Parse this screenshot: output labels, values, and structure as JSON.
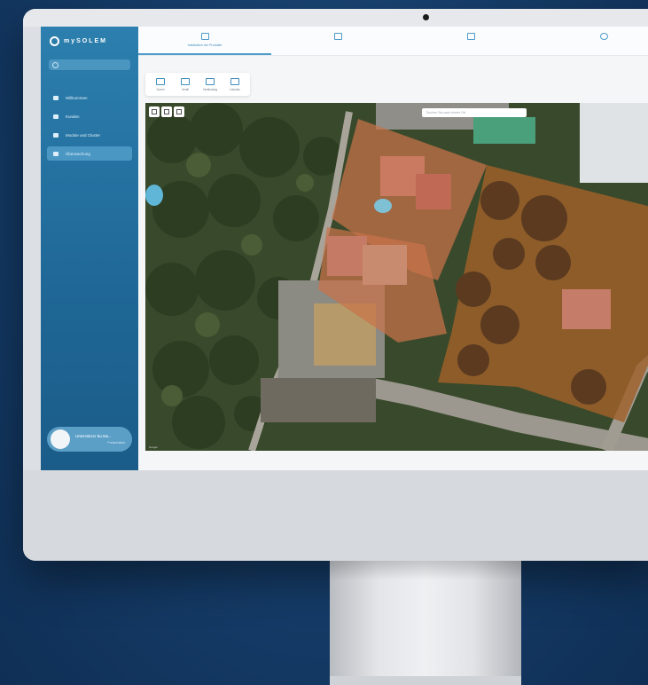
{
  "app": {
    "brand": "mySOLEM"
  },
  "sidebar": {
    "search_placeholder": "",
    "items": [
      {
        "label": "Willkommen",
        "icon": "home-icon"
      },
      {
        "label": "Kunden",
        "icon": "user-icon"
      },
      {
        "label": "Module und Cluster",
        "icon": "module-icon"
      },
      {
        "label": "Überwachung",
        "icon": "map-icon"
      }
    ],
    "active_index": 3,
    "user": {
      "name": "Unterstützer Bu Ma...",
      "role": "Freischalten"
    }
  },
  "tabs": [
    {
      "label": "Installation der Produkte",
      "icon": "layout-icon"
    },
    {
      "label": "",
      "icon": "calendar-icon"
    },
    {
      "label": "",
      "icon": "camera-icon"
    },
    {
      "label": "",
      "icon": "person-icon"
    }
  ],
  "active_tab": 0,
  "tools": [
    {
      "label": "Zonen",
      "icon": "sprinkler-icon"
    },
    {
      "label": "Ventil",
      "icon": "valve-icon"
    },
    {
      "label": "Verbindung",
      "icon": "link-icon"
    },
    {
      "label": "Löschen",
      "icon": "trash-icon"
    }
  ],
  "map": {
    "search_placeholder": "Suchen Sie nach einem Ort",
    "attribution": "Google",
    "attribution_right": ""
  },
  "colors": {
    "sidebar_top": "#2c7fae",
    "sidebar_bottom": "#1b5c89",
    "accent": "#4f9cc8",
    "zone_overlay": "#c7734a",
    "background": "#153c68"
  }
}
